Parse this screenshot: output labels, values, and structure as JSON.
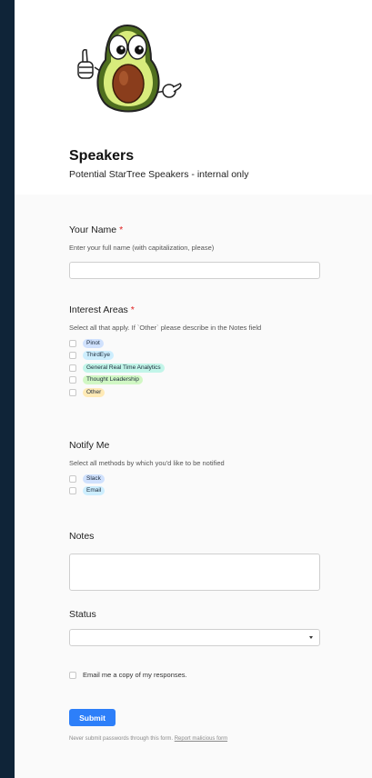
{
  "form": {
    "title": "Speakers",
    "description": "Potential StarTree Speakers - internal only",
    "logo_icon": "avocado-mascot-icon"
  },
  "fields": {
    "name": {
      "label": "Your Name",
      "required_mark": "*",
      "help": "Enter your full name (with capitalization, please)",
      "value": ""
    },
    "interests": {
      "label": "Interest Areas",
      "required_mark": "*",
      "help": "Select all that apply. If `Other` please describe in the Notes field",
      "options": [
        {
          "label": "Pinot",
          "color": "#d0e1fd",
          "checked": false
        },
        {
          "label": "ThirdEye",
          "color": "#cdeefe",
          "checked": false
        },
        {
          "label": "General Real Time Analytics",
          "color": "#c2f5e9",
          "checked": false
        },
        {
          "label": "Thought Leadership",
          "color": "#d1f7c4",
          "checked": false
        },
        {
          "label": "Other",
          "color": "#ffeab6",
          "checked": false
        }
      ]
    },
    "notify": {
      "label": "Notify Me",
      "help": "Select all methods by which you'd like to be notified",
      "options": [
        {
          "label": "Slack",
          "color": "#d0e1fd",
          "checked": false
        },
        {
          "label": "Email",
          "color": "#cdeefe",
          "checked": false
        }
      ]
    },
    "notes": {
      "label": "Notes",
      "value": ""
    },
    "status": {
      "label": "Status",
      "value": ""
    }
  },
  "email_copy": {
    "label": "Email me a copy of my responses.",
    "checked": false
  },
  "submit_label": "Submit",
  "footer": {
    "text": "Never submit passwords through this form.",
    "link": "Report malicious form"
  },
  "colors": {
    "page_background": "#0f2438",
    "accent": "#2d7ff9",
    "required": "#e02020"
  }
}
